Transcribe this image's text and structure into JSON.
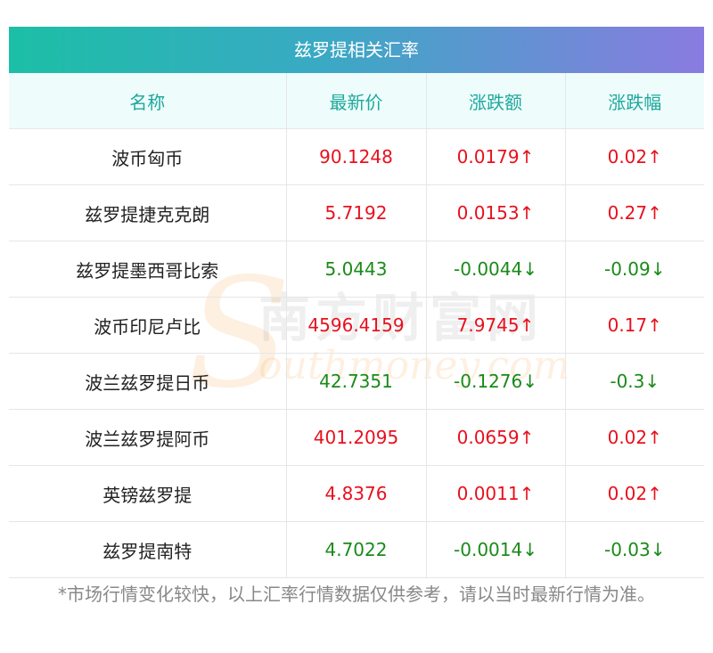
{
  "title": "兹罗提相关汇率",
  "headers": [
    "名称",
    "最新价",
    "涨跌额",
    "涨跌幅"
  ],
  "rows": [
    {
      "name": "波币匈币",
      "price": "90.1248",
      "change": "0.0179↑",
      "pct": "0.02↑",
      "dir": "up"
    },
    {
      "name": "兹罗提捷克克朗",
      "price": "5.7192",
      "change": "0.0153↑",
      "pct": "0.27↑",
      "dir": "up"
    },
    {
      "name": "兹罗提墨西哥比索",
      "price": "5.0443",
      "change": "-0.0044↓",
      "pct": "-0.09↓",
      "dir": "down"
    },
    {
      "name": "波币印尼卢比",
      "price": "4596.4159",
      "change": "7.9745↑",
      "pct": "0.17↑",
      "dir": "up"
    },
    {
      "name": "波兰兹罗提日币",
      "price": "42.7351",
      "change": "-0.1276↓",
      "pct": "-0.3↓",
      "dir": "down"
    },
    {
      "name": "波兰兹罗提阿币",
      "price": "401.2095",
      "change": "0.0659↑",
      "pct": "0.02↑",
      "dir": "up"
    },
    {
      "name": "英镑兹罗提",
      "price": "4.8376",
      "change": "0.0011↑",
      "pct": "0.02↑",
      "dir": "up"
    },
    {
      "name": "兹罗提南特",
      "price": "4.7022",
      "change": "-0.0014↓",
      "pct": "-0.03↓",
      "dir": "down"
    }
  ],
  "watermark": {
    "cn": "南方财富网",
    "en": "outhmoney.com",
    "letter": "S"
  },
  "footnote": "*市场行情变化较快，以上汇率行情数据仅供参考，请以当时最新行情为准。",
  "colors": {
    "up": "#e8101e",
    "down": "#1a8a1a",
    "header_text": "#1ea89c"
  }
}
